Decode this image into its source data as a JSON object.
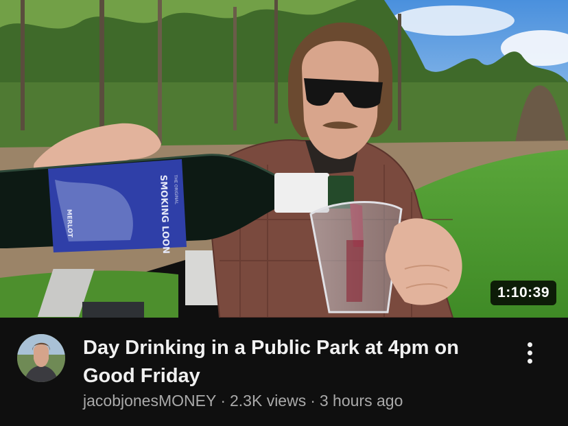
{
  "video": {
    "title": "Day Drinking in a Public Park at 4pm on Good Friday",
    "duration": "1:10:39",
    "channel": "jacobjonesMONEY",
    "views": "2.3K views",
    "age": "3 hours ago",
    "separator": "·"
  },
  "thumbnail": {
    "bottle_label_brand": "SMOKING LOON",
    "bottle_label_variety": "MERLOT",
    "bottle_label_small": "THE ORIGINAL"
  },
  "icons": {
    "more": "kebab-vertical-icon"
  },
  "colors": {
    "background": "#0f0f0f",
    "title": "#f1f1f1",
    "secondary_text": "#aaaaaa",
    "duration_badge": "#000000",
    "bottle_label": "#2f3fa8",
    "wine": "#8b1020"
  }
}
